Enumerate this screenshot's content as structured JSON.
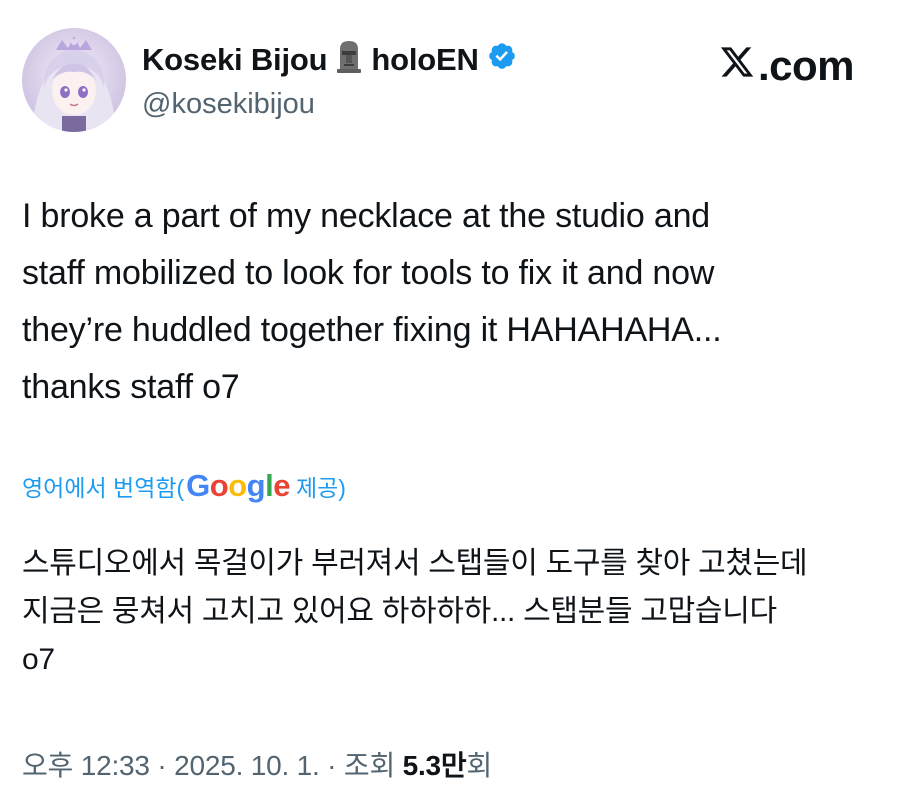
{
  "author": {
    "display_name": "Koseki Bijou",
    "affiliation": "holoEN",
    "handle": "@kosekibijou",
    "avatar_icon": "avatar-image",
    "name_emoji_icon": "moai-icon",
    "verified_icon": "verified-badge-icon"
  },
  "brand": {
    "label": ".com",
    "icon": "x-logo-icon"
  },
  "tweet": {
    "text": "I broke a part of my necklace at the studio and\nstaff mobilized to look for tools to fix it and now\nthey’re huddled together fixing it HAHAHAHA...\nthanks staff o7"
  },
  "translation": {
    "prefix": "영어에서 번역함(",
    "provider": "Google",
    "suffix": " 제공)",
    "text": "스튜디오에서 목걸이가 부러져서 스탭들이 도구를 찾아 고쳤는데\n지금은 뭉쳐서 고치고 있어요 하하하하... 스탭분들 고맙습니다\no7"
  },
  "meta": {
    "time": "오후 12:33",
    "separator": " · ",
    "date": "2025. 10. 1.",
    "views_label": "조회 ",
    "views_count": "5.3만",
    "views_suffix": "회"
  },
  "colors": {
    "link_blue": "#1d9bf0",
    "secondary_text": "#536471",
    "primary_text": "#0f1419",
    "verified_blue": "#1d9bf0"
  }
}
